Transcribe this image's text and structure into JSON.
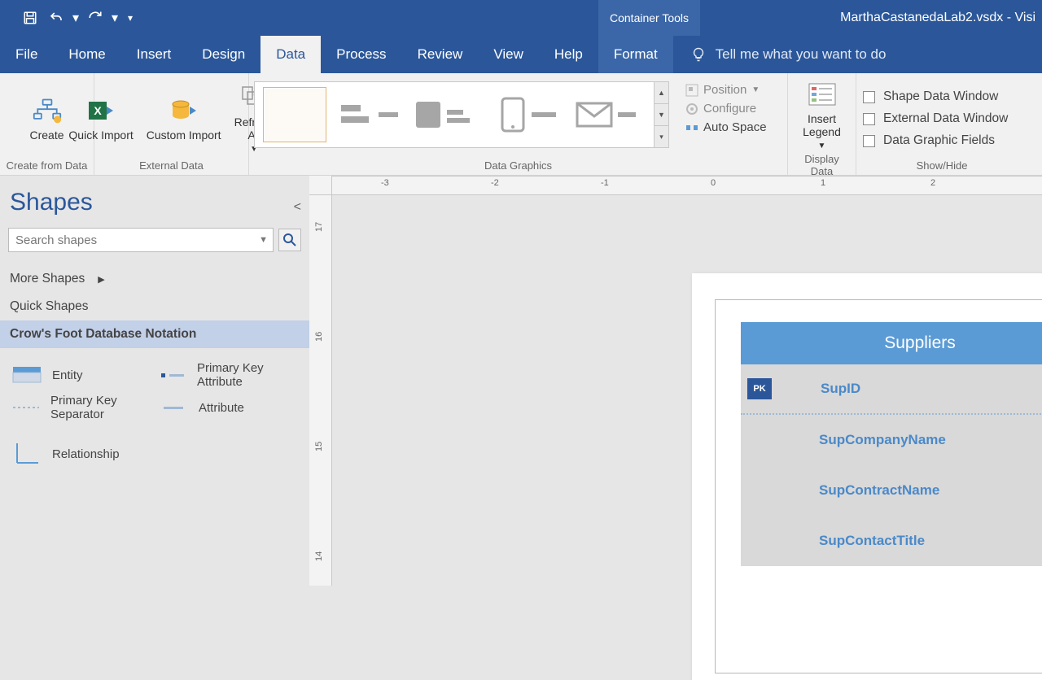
{
  "title": {
    "tool_context": "Container Tools",
    "document": "MarthaCastanedaLab2.vsdx  -  Visi"
  },
  "tabs": [
    "File",
    "Home",
    "Insert",
    "Design",
    "Data",
    "Process",
    "Review",
    "View",
    "Help",
    "Format"
  ],
  "tellme": "Tell me what you want to do",
  "ribbon": {
    "create": "Create",
    "create_group": "Create from Data",
    "quick_import": "Quick Import",
    "custom_import": "Custom Import",
    "refresh_all": "Refresh All",
    "external_group": "External Data",
    "dg_group": "Data Graphics",
    "position": "Position",
    "configure": "Configure",
    "auto_space": "Auto Space",
    "insert_legend": "Insert Legend",
    "display_group": "Display Data",
    "chk1": "Shape Data Window",
    "chk2": "External Data Window",
    "chk3": "Data Graphic Fields",
    "showhide_group": "Show/Hide"
  },
  "shapes": {
    "title": "Shapes",
    "search_placeholder": "Search shapes",
    "more": "More Shapes",
    "quick": "Quick Shapes",
    "stencil": "Crow's Foot Database Notation",
    "items": {
      "entity": "Entity",
      "pka": "Primary Key Attribute",
      "pks": "Primary Key Separator",
      "attr": "Attribute",
      "rel": "Relationship"
    }
  },
  "ruler_h": [
    "-3",
    "-2",
    "-1",
    "0",
    "1",
    "2"
  ],
  "ruler_v": [
    "17",
    "16",
    "15",
    "14"
  ],
  "entity": {
    "name": "Suppliers",
    "pk_badge": "PK",
    "rows": [
      "SupID",
      "SupCompanyName",
      "SupContractName",
      "SupContactTitle"
    ]
  }
}
